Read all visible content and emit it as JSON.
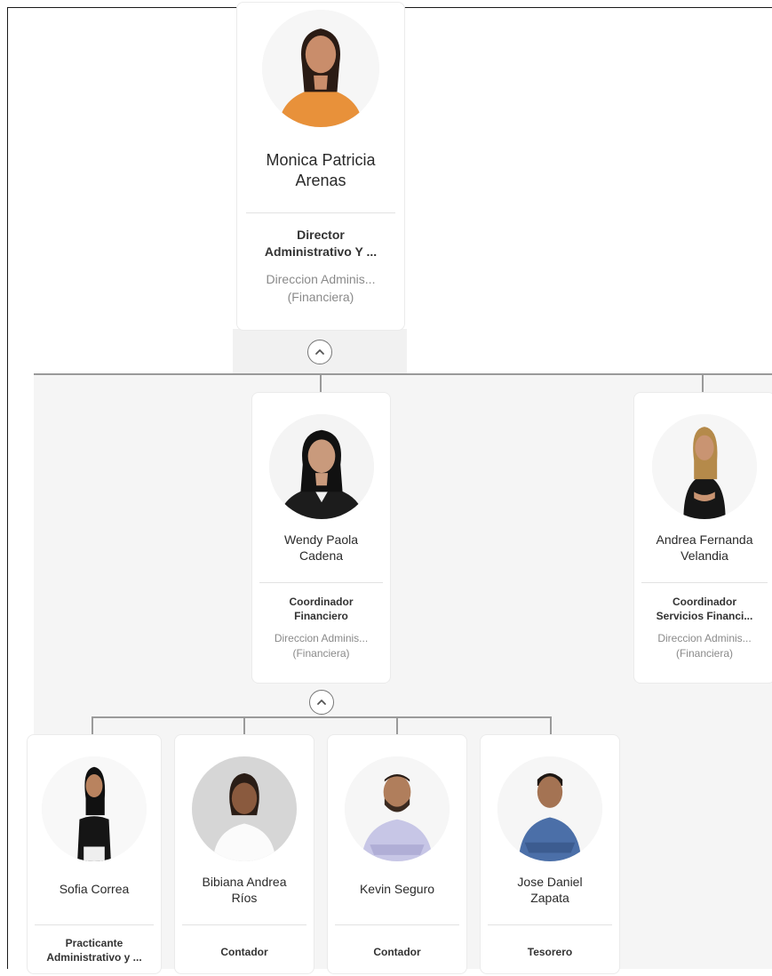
{
  "manager": {
    "name_line1": "Monica Patricia",
    "name_line2": "Arenas",
    "role_line1": "Director",
    "role_line2": "Administrativo Y ...",
    "dept_line1": "Direccion Adminis...",
    "dept_line2": "(Financiera)",
    "avatar_icon": "person-photo-orange-top"
  },
  "level2": [
    {
      "name_line1": "Wendy Paola",
      "name_line2": "Cadena",
      "role_line1": "Coordinador",
      "role_line2": "Financiero",
      "dept_line1": "Direccion Adminis...",
      "dept_line2": "(Financiera)",
      "avatar_icon": "person-photo-black-jacket"
    },
    {
      "name_line1": "Andrea Fernanda",
      "name_line2": "Velandia",
      "role_line1": "Coordinador",
      "role_line2": "Servicios Financi...",
      "dept_line1": "Direccion Adminis...",
      "dept_line2": "(Financiera)",
      "avatar_icon": "person-photo-black-outfit"
    }
  ],
  "level3": [
    {
      "name_line1": "Sofia Correa",
      "name_line2": "",
      "role_line1": "Practicante",
      "role_line2": "Administrativo y ...",
      "avatar_icon": "person-photo-black-top"
    },
    {
      "name_line1": "Bibiana Andrea",
      "name_line2": "Ríos",
      "role_line1": "Contador",
      "role_line2": "",
      "avatar_icon": "person-photo-white-blouse"
    },
    {
      "name_line1": "Kevin Seguro",
      "name_line2": "",
      "role_line1": "Contador",
      "role_line2": "",
      "avatar_icon": "person-photo-lavender-shirt"
    },
    {
      "name_line1": "Jose Daniel",
      "name_line2": "Zapata",
      "role_line1": "Tesorero",
      "role_line2": "",
      "avatar_icon": "person-photo-blue-shirt"
    }
  ],
  "toggle_icon": "chevron-up-icon",
  "colors": {
    "background": "#ffffff",
    "canvas": "#f5f5f5",
    "card": "#ffffff",
    "connector": "#9a9a9a",
    "name_text": "#2a2a2a",
    "dept_text": "#8a8a8a"
  }
}
